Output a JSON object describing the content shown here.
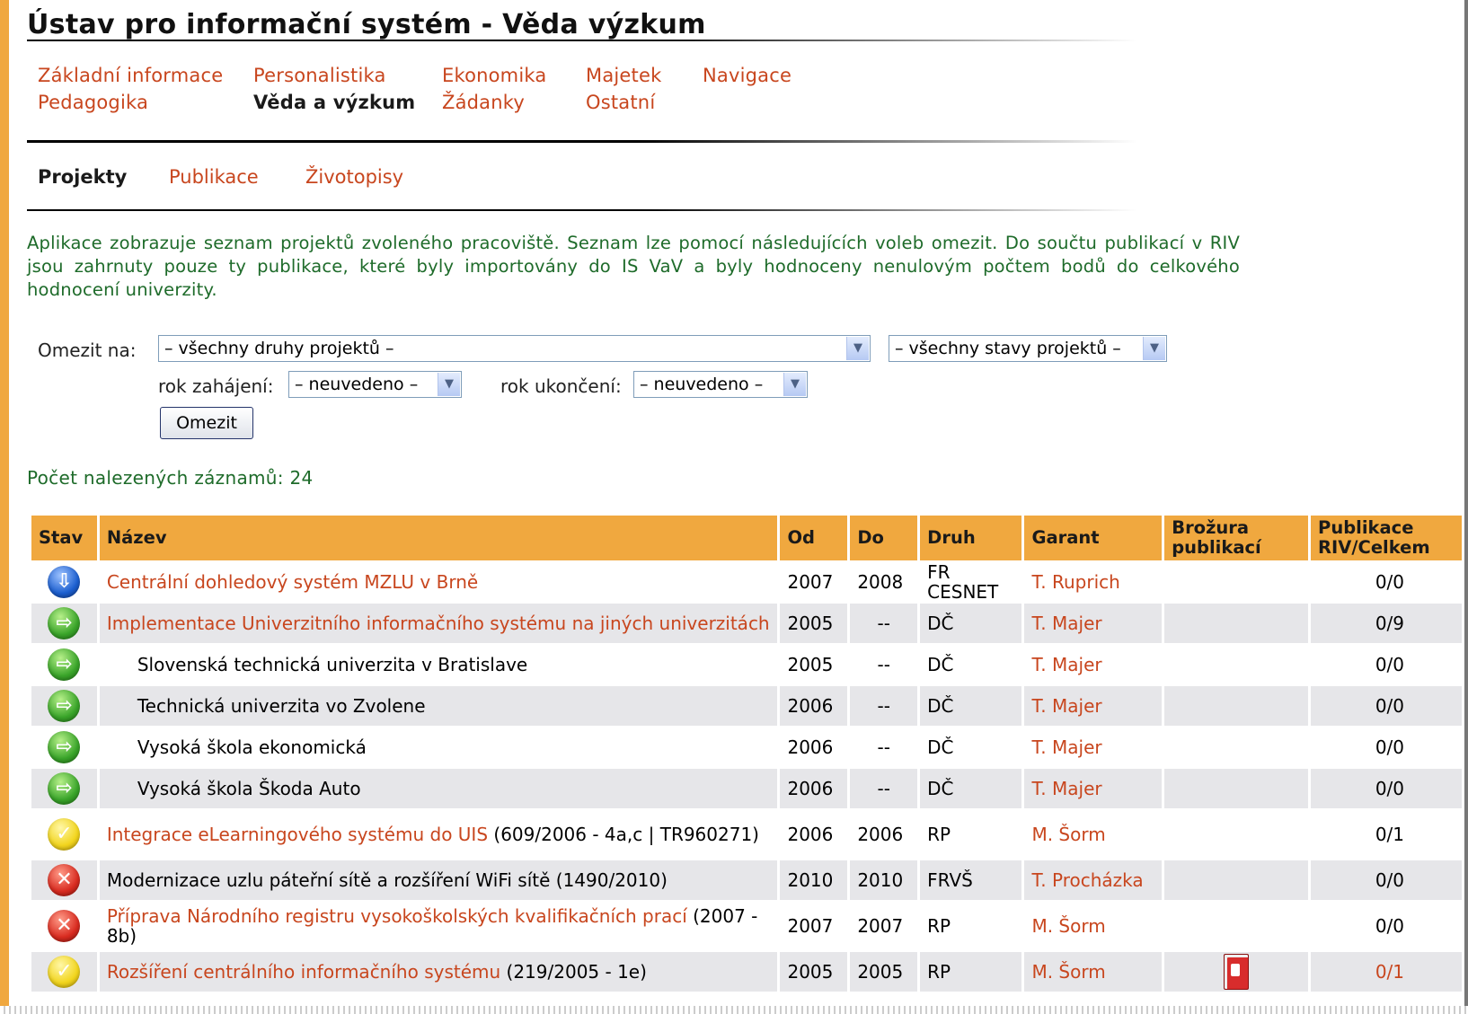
{
  "title": "Ústav pro informační systém - Věda výzkum",
  "main_nav": [
    {
      "label": "Základní informace",
      "col": 0,
      "row": 0
    },
    {
      "label": "Pedagogika",
      "col": 0,
      "row": 1
    },
    {
      "label": "Personalistika",
      "col": 1,
      "row": 0
    },
    {
      "label": "Věda a výzkum",
      "col": 1,
      "row": 1,
      "active": true
    },
    {
      "label": "Ekonomika",
      "col": 2,
      "row": 0
    },
    {
      "label": "Žádanky",
      "col": 2,
      "row": 1
    },
    {
      "label": "Majetek",
      "col": 3,
      "row": 0
    },
    {
      "label": "Ostatní",
      "col": 3,
      "row": 1
    },
    {
      "label": "Navigace",
      "col": 4,
      "row": 0
    }
  ],
  "sub_nav": [
    "Projekty",
    "Publikace",
    "Životopisy"
  ],
  "description": "Aplikace zobrazuje seznam projektů zvoleného pracoviště. Seznam lze pomocí následujících voleb omezit. Do součtu publikací v RIV jsou zahrnuty pouze ty publikace, které byly importovány do IS VaV a byly hodnoceny nenulovým počtem bodů do celkového hodnocení univerzity.",
  "filter": {
    "label": "Omezit na:",
    "project_type": "– všechny druhy projektů –",
    "project_state": "– všechny stavy projektů –",
    "start_label": "rok zahájení:",
    "start_value": "– neuvedeno –",
    "end_label": "rok ukončení:",
    "end_value": "– neuvedeno –",
    "button": "Omezit"
  },
  "count_label": "Počet nalezených záznamů: 24",
  "columns": [
    "Stav",
    "Název",
    "Od",
    "Do",
    "Druh",
    "Garant",
    "Brožura publikací",
    "Publikace RIV/Celkem"
  ],
  "rows": [
    {
      "status": "blue",
      "status_icon": "info-icon",
      "name_link": "Centrální dohledový systém MZLU v Brně",
      "name_extra": "",
      "indent": false,
      "from": "2007",
      "to": "2008",
      "type": "FR CESNET",
      "guarantor": "T. Ruprich",
      "brochure": false,
      "pubs": "0/0",
      "pubs_link": false
    },
    {
      "status": "green",
      "status_icon": "arrow-icon",
      "name_link": "Implementace Univerzitního informačního systému na jiných univerzitách",
      "name_extra": "",
      "indent": false,
      "from": "2005",
      "to": "--",
      "type": "DČ",
      "guarantor": "T. Majer",
      "brochure": false,
      "pubs": "0/9",
      "pubs_link": false
    },
    {
      "status": "green",
      "status_icon": "arrow-icon",
      "name_link": "",
      "name_extra": "Slovenská technická univerzita v Bratislave",
      "indent": true,
      "from": "2005",
      "to": "--",
      "type": "DČ",
      "guarantor": "T. Majer",
      "brochure": false,
      "pubs": "0/0",
      "pubs_link": false
    },
    {
      "status": "green",
      "status_icon": "arrow-icon",
      "name_link": "",
      "name_extra": "Technická univerzita vo Zvolene",
      "indent": true,
      "from": "2006",
      "to": "--",
      "type": "DČ",
      "guarantor": "T. Majer",
      "brochure": false,
      "pubs": "0/0",
      "pubs_link": false
    },
    {
      "status": "green",
      "status_icon": "arrow-icon",
      "name_link": "",
      "name_extra": "Vysoká škola ekonomická",
      "indent": true,
      "from": "2006",
      "to": "--",
      "type": "DČ",
      "guarantor": "T. Majer",
      "brochure": false,
      "pubs": "0/0",
      "pubs_link": false
    },
    {
      "status": "green",
      "status_icon": "arrow-icon",
      "name_link": "",
      "name_extra": "Vysoká škola Škoda Auto",
      "indent": true,
      "from": "2006",
      "to": "--",
      "type": "DČ",
      "guarantor": "T. Majer",
      "brochure": false,
      "pubs": "0/0",
      "pubs_link": false
    },
    {
      "status": "yellow",
      "status_icon": "check-icon",
      "name_link": "Integrace eLearningového systému do UIS",
      "name_extra": " (609/2006 - 4a,c | TR960271)",
      "indent": false,
      "from": "2006",
      "to": "2006",
      "type": "RP",
      "guarantor": "M. Šorm",
      "brochure": false,
      "pubs": "0/1",
      "pubs_link": false
    },
    {
      "status": "red",
      "status_icon": "cross-icon",
      "name_link": "",
      "name_extra": "Modernizace uzlu páteřní sítě a rozšíření WiFi sítě (1490/2010)",
      "indent": false,
      "from": "2010",
      "to": "2010",
      "type": "FRVŠ",
      "guarantor": "T. Procházka",
      "brochure": false,
      "pubs": "0/0",
      "pubs_link": false
    },
    {
      "status": "red",
      "status_icon": "cross-icon",
      "name_link": "Příprava Národního registru vysokoškolských kvalifikačních prací",
      "name_extra": " (2007 - 8b)",
      "indent": false,
      "from": "2007",
      "to": "2007",
      "type": "RP",
      "guarantor": "M. Šorm",
      "brochure": false,
      "pubs": "0/0",
      "pubs_link": false
    },
    {
      "status": "yellow",
      "status_icon": "check-icon",
      "name_link": "Rozšíření centrálního informačního systému",
      "name_extra": " (219/2005 - 1e)",
      "indent": false,
      "from": "2005",
      "to": "2005",
      "type": "RP",
      "guarantor": "M. Šorm",
      "brochure": true,
      "pubs": "0/1",
      "pubs_link": true
    }
  ]
}
